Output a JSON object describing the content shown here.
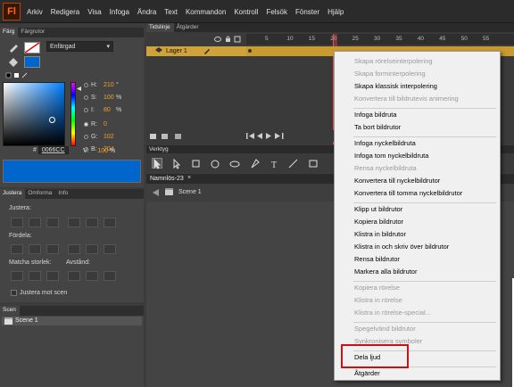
{
  "app": {
    "logo": "Fl"
  },
  "menu": [
    "Arkiv",
    "Redigera",
    "Visa",
    "Infoga",
    "Ändra",
    "Text",
    "Kommandon",
    "Kontroll",
    "Felsök",
    "Fönster",
    "Hjälp"
  ],
  "color_panel": {
    "tabs": [
      "Färg",
      "Färgrutor"
    ],
    "fill_type": "Enfärgad",
    "fields": [
      {
        "label": "H:",
        "value": "210",
        "unit": "°"
      },
      {
        "label": "S:",
        "value": "100",
        "unit": "%"
      },
      {
        "label": "I:",
        "value": "80",
        "unit": "%"
      },
      {
        "label": "R:",
        "value": "0",
        "unit": ""
      },
      {
        "label": "G:",
        "value": "102",
        "unit": ""
      },
      {
        "label": "B:",
        "value": "204",
        "unit": ""
      }
    ],
    "alpha_label": "V:",
    "alpha_value": "100",
    "alpha_unit": "%",
    "hex_label": "#",
    "hex": "0066CC",
    "color": "#0066cc"
  },
  "align_panel": {
    "tabs": [
      "Justera",
      "Omforma",
      "Info"
    ],
    "align_label": "Justera:",
    "distribute_label": "Fördela:",
    "match_label": "Matcha storlek:",
    "spacing_label": "Avstånd:",
    "to_stage": "Justera mot scen"
  },
  "scene_panel": {
    "tab": "Scen",
    "items": [
      "Scene 1"
    ]
  },
  "timeline": {
    "tabs": [
      "Tidslinje",
      "Åtgärder"
    ],
    "ruler": [
      "5",
      "10",
      "15",
      "20",
      "25",
      "30",
      "35",
      "40",
      "45",
      "50",
      "55"
    ],
    "layer": "Lager 1"
  },
  "tools": {
    "title": "Verktyg"
  },
  "document": {
    "tab": "Namnlös-23",
    "breadcrumb": "Scene 1"
  },
  "context_menu": [
    {
      "label": "Skapa rörelseinterpolering",
      "enabled": false
    },
    {
      "label": "Skapa forminterpolering",
      "enabled": false
    },
    {
      "label": "Skapa klassisk interpolering",
      "enabled": true
    },
    {
      "label": "Konvertera till bildrutevis animering",
      "enabled": false
    },
    {
      "sep": true
    },
    {
      "label": "Infoga bildruta",
      "enabled": true
    },
    {
      "label": "Ta bort bildrutor",
      "enabled": true
    },
    {
      "sep": true
    },
    {
      "label": "Infoga nyckelbildruta",
      "enabled": true
    },
    {
      "label": "Infoga tom nyckelbildruta",
      "enabled": true
    },
    {
      "label": "Rensa nyckelbildruta",
      "enabled": false
    },
    {
      "label": "Konvertera till nyckelbildrutor",
      "enabled": true
    },
    {
      "label": "Konvertera till tomma nyckelbildrutor",
      "enabled": true
    },
    {
      "sep": true
    },
    {
      "label": "Klipp ut bildrutor",
      "enabled": true
    },
    {
      "label": "Kopiera bildrutor",
      "enabled": true
    },
    {
      "label": "Klistra in bildrutor",
      "enabled": true
    },
    {
      "label": "Klistra in och skriv över bildrutor",
      "enabled": true
    },
    {
      "label": "Rensa bildrutor",
      "enabled": true
    },
    {
      "label": "Markera alla bildrutor",
      "enabled": true
    },
    {
      "sep": true
    },
    {
      "label": "Kopiera rörelse",
      "enabled": false
    },
    {
      "label": "Klistra in rörelse",
      "enabled": false
    },
    {
      "label": "Klistra in rörelse-special...",
      "enabled": false
    },
    {
      "sep": true
    },
    {
      "label": "Spegelvänd bildrutor",
      "enabled": false
    },
    {
      "label": "Synkronisera symboler",
      "enabled": false
    },
    {
      "sep": true
    },
    {
      "label": "Dela ljud",
      "enabled": true
    },
    {
      "sep": true
    },
    {
      "label": "Åtgärder",
      "enabled": true
    }
  ]
}
